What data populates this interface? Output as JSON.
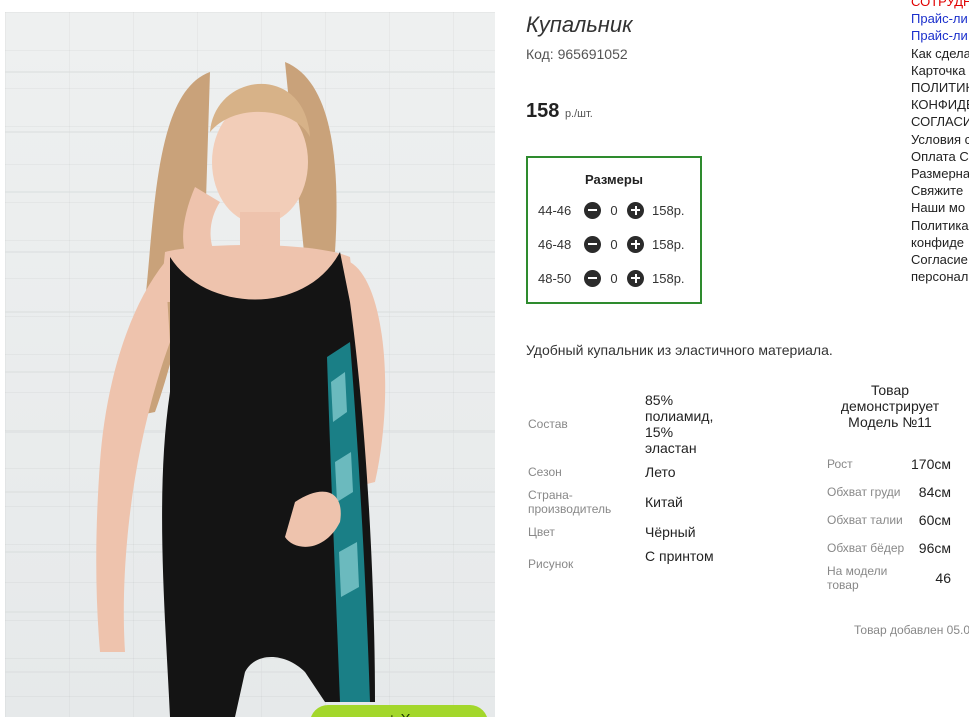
{
  "product": {
    "title": "Купальник",
    "code": "Код: 965691052",
    "price": "158",
    "price_unit": "р./шт.",
    "description": "Удобный купальник из эластичного материала."
  },
  "sizes": {
    "title": "Размеры",
    "rows": [
      {
        "size": "44-46",
        "qty": "0",
        "price": "158р."
      },
      {
        "size": "46-48",
        "qty": "0",
        "price": "158р."
      },
      {
        "size": "48-50",
        "qty": "0",
        "price": "158р."
      }
    ]
  },
  "attributes": [
    {
      "label": "Состав",
      "value": "85% полиамид, 15% эластан"
    },
    {
      "label": "Сезон",
      "value": "Лето"
    },
    {
      "label": "Страна-производитель",
      "value": "Китай"
    },
    {
      "label": "Цвет",
      "value": "Чёрный"
    },
    {
      "label": "Рисунок",
      "value": "С принтом"
    }
  ],
  "model": {
    "heading": "Товар демонстрирует Модель №11",
    "params": [
      {
        "label": "Рост",
        "value": "170см"
      },
      {
        "label": "Обхват груди",
        "value": "84см"
      },
      {
        "label": "Обхват талии",
        "value": "60см"
      },
      {
        "label": "Обхват бёдер",
        "value": "96см"
      },
      {
        "label": "На модели товар",
        "value": "46"
      }
    ]
  },
  "added_text": "Товар добавлен 05.0",
  "cart_button": "+ Х",
  "right_links": [
    {
      "text": "СОТРУДН",
      "color": "red"
    },
    {
      "text": "Прайс-ли",
      "color": "blue"
    },
    {
      "text": "Прайс-ли",
      "color": "blue"
    },
    {
      "text": "Как сдела",
      "color": "dark"
    },
    {
      "text": "Карточка",
      "color": "dark"
    },
    {
      "text": "ПОЛИТИК",
      "color": "dark"
    },
    {
      "text": "КОНФИДЕ",
      "color": "dark"
    },
    {
      "text": "СОГЛАСИ",
      "color": "dark"
    },
    {
      "text": "Условия с",
      "color": "dark"
    },
    {
      "text": "Оплата С",
      "color": "dark"
    },
    {
      "text": "Размерна",
      "color": "dark"
    },
    {
      "text": "Свяжите",
      "color": "dark"
    },
    {
      "text": "Наши мо",
      "color": "dark"
    },
    {
      "text": "Политика",
      "color": "dark"
    },
    {
      "text": "конфиде",
      "color": "dark"
    },
    {
      "text": "Согласие",
      "color": "dark"
    },
    {
      "text": "персонал",
      "color": "dark"
    }
  ],
  "colors": {
    "accent_green": "#2e8b2e",
    "cart_green": "#a3d72b",
    "link_blue": "#1a2fcc",
    "link_red": "#e00000"
  }
}
